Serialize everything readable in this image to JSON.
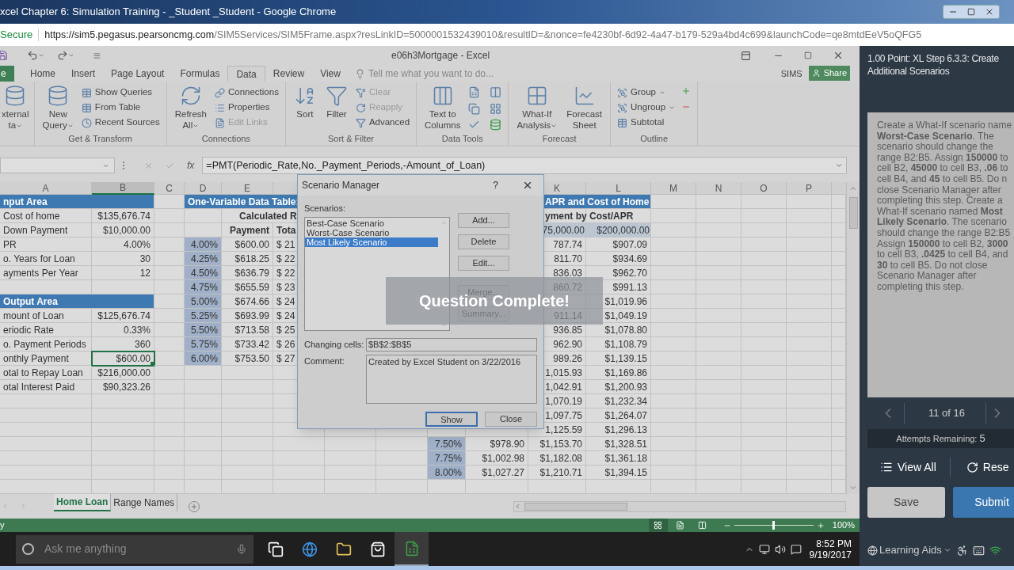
{
  "browser": {
    "title": "xcel Chapter 6: Simulation Training - _Student _Student - Google Chrome",
    "secure_label": "Secure",
    "url_origin": "https://sim5.pegasus.pearsoncmg.com",
    "url_path": "/SIM5Services/SIM5Frame.aspx?resLinkID=5000001532439010&resultID=&nonce=fe4230bf-6d92-4a47-b179-529a4bd4c699&launchCode=qe8mtdEeV5oQFG5"
  },
  "excel": {
    "title": "e06h3Mortgage - Excel",
    "file_tab": "e",
    "tabs": [
      {
        "label": "Home",
        "selected": false
      },
      {
        "label": "Insert",
        "selected": false
      },
      {
        "label": "Page Layout",
        "selected": false
      },
      {
        "label": "Formulas",
        "selected": false
      },
      {
        "label": "Data",
        "selected": true
      },
      {
        "label": "Review",
        "selected": false
      },
      {
        "label": "View",
        "selected": false
      }
    ],
    "tell_me": "Tell me what you want to do...",
    "user": "SIMS",
    "share": "Share",
    "ribbon_groups": [
      {
        "big": [
          {
            "lines": [
              "xternal",
              "ta"
            ],
            "dropdown": true
          }
        ]
      },
      {
        "label": "Get & Transform",
        "big": [
          {
            "lines": [
              "New",
              "Query"
            ],
            "dropdown": true
          }
        ],
        "small": [
          {
            "label": "Show Queries",
            "disabled": false
          },
          {
            "label": "From Table",
            "disabled": false
          },
          {
            "label": "Recent Sources",
            "disabled": false
          }
        ]
      },
      {
        "label": "Connections",
        "big": [
          {
            "lines": [
              "Refresh",
              "All"
            ],
            "dropdown": true
          }
        ],
        "small": [
          {
            "label": "Connections",
            "disabled": false
          },
          {
            "label": "Properties",
            "disabled": false
          },
          {
            "label": "Edit Links",
            "disabled": true
          }
        ]
      },
      {
        "label": "Sort & Filter",
        "big": [
          {
            "lines": [
              "Sort"
            ],
            "dropdown": false
          },
          {
            "lines": [
              "Filter"
            ],
            "dropdown": false
          }
        ],
        "small": [
          {
            "label": "Clear",
            "disabled": true
          },
          {
            "label": "Reapply",
            "disabled": true
          },
          {
            "label": "Advanced",
            "disabled": false
          }
        ]
      },
      {
        "label": "Data Tools",
        "big": [
          {
            "lines": [
              "Text to",
              "Columns"
            ],
            "dropdown": false
          }
        ]
      },
      {
        "label": "Forecast",
        "big": [
          {
            "lines": [
              "What-If",
              "Analysis"
            ],
            "dropdown": true
          },
          {
            "lines": [
              "Forecast",
              "Sheet"
            ],
            "dropdown": false
          }
        ]
      },
      {
        "label": "Outline",
        "small": [
          {
            "label": "Group",
            "disabled": false,
            "dropdown": true
          },
          {
            "label": "Ungroup",
            "disabled": false,
            "dropdown": true
          },
          {
            "label": "Subtotal",
            "disabled": false,
            "dropdown": false
          }
        ]
      }
    ],
    "function_label": "fx",
    "formula": "=PMT(Periodic_Rate,No._Payment_Periods,-Amount_of_Loan)",
    "columns": {
      "A": {
        "label": "A",
        "selected": false
      },
      "B": {
        "label": "B",
        "selected": true
      },
      "C": {
        "label": "C",
        "selected": false
      },
      "D": {
        "label": "D",
        "selected": false
      },
      "E": {
        "label": "E",
        "selected": false
      },
      "K": {
        "label": "K",
        "selected": false
      },
      "L": {
        "label": "L",
        "selected": false
      },
      "M": {
        "label": "M",
        "selected": false
      },
      "N": {
        "label": "N",
        "selected": false
      },
      "O": {
        "label": "O",
        "selected": false
      },
      "P": {
        "label": "P",
        "selected": false
      }
    },
    "rows": [
      {
        "A": {
          "text": "nput Area",
          "kind": "section"
        },
        "D": {
          "text": "One-Variable Data Table:",
          "kind": "wide_section"
        },
        "K": {
          "text": "APR and Cost of Home",
          "kind": "section_right"
        }
      },
      {
        "A": {
          "text": "Cost of home",
          "kind": "label"
        },
        "B": {
          "text": "$135,676.74"
        },
        "E": {
          "text": "Calculated R",
          "kind": "heading"
        },
        "K": {
          "text": "yment by Cost/APR",
          "kind": "heading_right"
        }
      },
      {
        "A": {
          "text": "Down Payment",
          "kind": "label"
        },
        "B": {
          "symbol": "$",
          "text": "10,000.00"
        },
        "E": {
          "text": "Payment",
          "kind": "heading_num"
        },
        "F": {
          "text": "Tota",
          "kind": "heading_left"
        },
        "K": {
          "text": "75,000.00",
          "kind": "light"
        },
        "L": {
          "symbol": "$",
          "text": "200,000.00",
          "kind": "light"
        }
      },
      {
        "A": {
          "text": "PR",
          "kind": "label"
        },
        "B": {
          "text": "4.00%"
        },
        "D": {
          "text": "4.00%",
          "kind": "shaded"
        },
        "E": {
          "symbol": "$",
          "text": "600.00"
        },
        "F": {
          "text": "$ 21",
          "kind": "label"
        },
        "K": {
          "text": "787.74"
        },
        "L": {
          "symbol": "$",
          "text": "907.09"
        }
      },
      {
        "A": {
          "text": "o. Years for Loan",
          "kind": "label"
        },
        "B": {
          "text": "30"
        },
        "D": {
          "text": "4.25%",
          "kind": "shaded"
        },
        "E": {
          "symbol": "$",
          "text": "618.25"
        },
        "F": {
          "text": "$ 22",
          "kind": "label"
        },
        "K": {
          "text": "811.70"
        },
        "L": {
          "symbol": "$",
          "text": "934.69"
        }
      },
      {
        "A": {
          "text": "ayments Per Year",
          "kind": "label"
        },
        "B": {
          "text": "12"
        },
        "D": {
          "text": "4.50%",
          "kind": "shaded"
        },
        "E": {
          "symbol": "$",
          "text": "636.79"
        },
        "F": {
          "text": "$ 22",
          "kind": "label"
        },
        "K": {
          "text": "836.03"
        },
        "L": {
          "symbol": "$",
          "text": "962.70"
        }
      },
      {
        "D": {
          "text": "4.75%",
          "kind": "shaded"
        },
        "E": {
          "symbol": "$",
          "text": "655.59"
        },
        "F": {
          "text": "$ 23",
          "kind": "label"
        },
        "K": {
          "text": "860.72"
        },
        "L": {
          "symbol": "$",
          "text": "991.13"
        }
      },
      {
        "A": {
          "text": "Output Area",
          "kind": "section"
        },
        "D": {
          "text": "5.00%",
          "kind": "shaded"
        },
        "E": {
          "symbol": "$",
          "text": "674.66"
        },
        "F": {
          "text": "$ 24",
          "kind": "label"
        },
        "L": {
          "symbol": "$",
          "text": "1,019.96"
        }
      },
      {
        "A": {
          "text": "mount of Loan",
          "kind": "label"
        },
        "B": {
          "text": "$125,676.74"
        },
        "D": {
          "text": "5.25%",
          "kind": "shaded"
        },
        "E": {
          "symbol": "$",
          "text": "693.99"
        },
        "F": {
          "text": "$ 24",
          "kind": "label"
        },
        "K": {
          "text": "911.14"
        },
        "L": {
          "symbol": "$",
          "text": "1,049.19"
        }
      },
      {
        "A": {
          "text": "eriodic Rate",
          "kind": "label"
        },
        "B": {
          "text": "0.33%"
        },
        "D": {
          "text": "5.50%",
          "kind": "shaded"
        },
        "E": {
          "symbol": "$",
          "text": "713.58"
        },
        "F": {
          "text": "$ 25",
          "kind": "label"
        },
        "K": {
          "text": "936.85"
        },
        "L": {
          "symbol": "$",
          "text": "1,078.80"
        }
      },
      {
        "A": {
          "text": "o. Payment Periods",
          "kind": "label"
        },
        "B": {
          "text": "360"
        },
        "D": {
          "text": "5.75%",
          "kind": "shaded"
        },
        "E": {
          "symbol": "$",
          "text": "733.42"
        },
        "F": {
          "text": "$ 26",
          "kind": "label"
        },
        "K": {
          "text": "962.90"
        },
        "L": {
          "symbol": "$",
          "text": "1,108.79"
        }
      },
      {
        "A": {
          "text": "onthly Payment",
          "kind": "label"
        },
        "B": {
          "text": "$600.00",
          "kind": "selected"
        },
        "D": {
          "text": "6.00%",
          "kind": "shaded"
        },
        "E": {
          "symbol": "$",
          "text": "753.50"
        },
        "F": {
          "text": "$ 27",
          "kind": "label"
        },
        "K": {
          "text": "989.26"
        },
        "L": {
          "symbol": "$",
          "text": "1,139.15"
        }
      },
      {
        "A": {
          "text": "otal to Repay Loan",
          "kind": "label"
        },
        "B": {
          "text": "$216,000.00"
        },
        "K": {
          "text": "1,015.93"
        },
        "L": {
          "symbol": "$",
          "text": "1,169.86"
        }
      },
      {
        "A": {
          "text": "otal Interest Paid",
          "kind": "label"
        },
        "B": {
          "symbol": "$",
          "text": "90,323.26"
        },
        "K": {
          "text": "1,042.91"
        },
        "L": {
          "symbol": "$",
          "text": "1,200.93"
        }
      },
      {
        "K": {
          "text": "1,070.19"
        },
        "L": {
          "symbol": "$",
          "text": "1,232.34"
        }
      },
      {
        "K": {
          "text": "1,097.75"
        },
        "L": {
          "symbol": "$",
          "text": "1,264.07"
        }
      },
      {
        "K": {
          "text": "1,125.59"
        },
        "L": {
          "symbol": "$",
          "text": "1,296.13"
        }
      },
      {
        "I": {
          "text": "7.50%",
          "kind": "shaded"
        },
        "J": {
          "symbol": "$",
          "text": "978.90"
        },
        "K": {
          "symbol": "$",
          "text": "1,153.70"
        },
        "L": {
          "symbol": "$",
          "text": "1,328.51"
        }
      },
      {
        "I": {
          "text": "7.75%",
          "kind": "shaded"
        },
        "J": {
          "symbol": "$",
          "text": "1,002.98"
        },
        "K": {
          "symbol": "$",
          "text": "1,182.08"
        },
        "L": {
          "symbol": "$",
          "text": "1,361.18"
        }
      },
      {
        "I": {
          "text": "8.00%",
          "kind": "shaded"
        },
        "J": {
          "symbol": "$",
          "text": "1,027.27"
        },
        "K": {
          "symbol": "$",
          "text": "1,210.71"
        },
        "L": {
          "symbol": "$",
          "text": "1,394.15"
        }
      },
      {}
    ],
    "sheets": [
      {
        "label": "Home Loan",
        "selected": true
      },
      {
        "label": "Range Names",
        "selected": false
      }
    ],
    "status": "y",
    "views": [
      {
        "selected": true
      },
      {
        "selected": false
      },
      {
        "selected": false
      }
    ],
    "zoom": {
      "level": 0.5,
      "reading": "100%"
    }
  },
  "dialog": {
    "title": "Scenario Manager",
    "help": "?",
    "list_label": "Scenarios:",
    "scenarios": [
      {
        "label": "Best-Case Scenario",
        "selected": false
      },
      {
        "label": "Worst-Case Scenario",
        "selected": false
      },
      {
        "label": "Most Likely Scenario",
        "selected": true
      }
    ],
    "buttons": [
      "Add...",
      "Delete",
      "Edit..."
    ],
    "buttons_lower": [
      "Merge...",
      "Summary..."
    ],
    "changing_label": "Changing cells:",
    "changing_value": "$B$2:$B$5",
    "comment_label": "Comment:",
    "comment_value": "Created by Excel Student on 3/22/2016",
    "footer_buttons": [
      {
        "label": "Show",
        "focused": true
      },
      {
        "label": "Close",
        "focused": false
      }
    ]
  },
  "toast": "Question Complete!",
  "panel": {
    "title": "1.00 Point: XL Step 6.3.3: Create Additional Scenarios",
    "instructions": [
      "Create a What-If scenario name",
      "**Worst-Case Scenario**. The",
      "scenario should change the",
      "range B2:B5. Assign **150000** to",
      "cell B2, **45000** to cell B3, **.06** to",
      "cell B4, and **45** to cell B5. Do n",
      "close Scenario Manager after",
      "completing this step. Create a",
      "What-If scenario named **Most**",
      "**Likely Scenario**. The scenario",
      "should change the range B2:B5",
      "Assign **150000** to cell B2, **3000**",
      "to cell B3, **.0425** to cell B4, and",
      "**30** to cell B5. Do not close",
      "Scenario Manager after",
      "completing this step."
    ],
    "progress": "11 of 16",
    "attempts_label": "Attempts Remaining:",
    "attempts": "5",
    "view_all": "View All",
    "reset": "Rese",
    "save": "Save",
    "submit": "Submit",
    "learning_aids": "Learning Aids"
  },
  "taskbar": {
    "search_placeholder": "Ask me anything",
    "apps": [
      {
        "active": false
      },
      {
        "active": false
      },
      {
        "active": false
      },
      {
        "active": false
      },
      {
        "active": true
      }
    ],
    "time": "8:52 PM",
    "date": "9/19/2017"
  }
}
